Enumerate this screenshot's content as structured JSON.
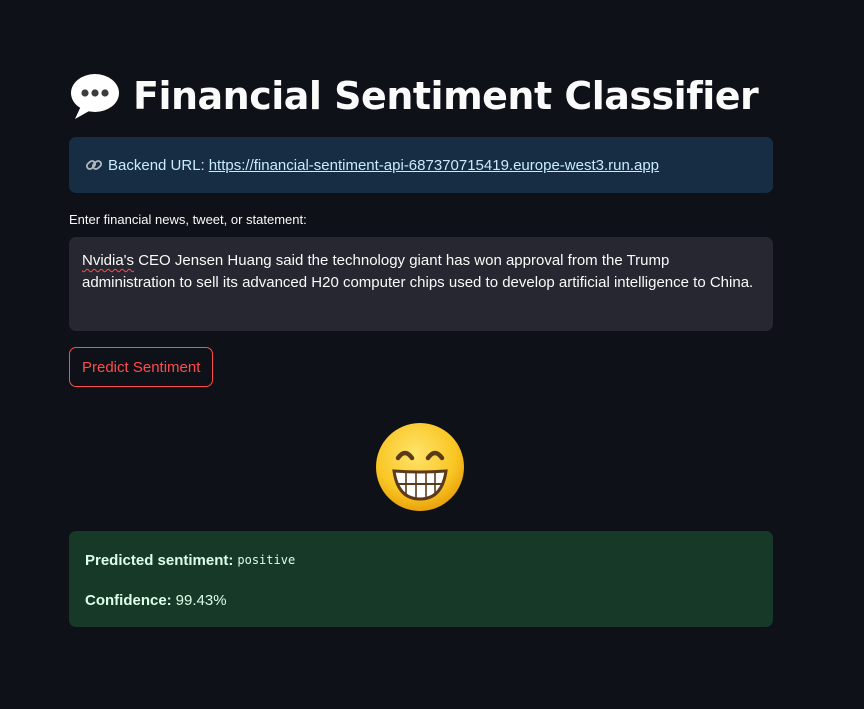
{
  "header": {
    "title_icon": "speech-balloon-icon",
    "title": "Financial Sentiment Classifier"
  },
  "backend": {
    "icon": "link-icon",
    "label": "Backend URL:",
    "url": "https://financial-sentiment-api-687370715419.europe-west3.run.app"
  },
  "input": {
    "label": "Enter financial news, tweet, or statement:",
    "value_first_word": "Nvidia's",
    "value_rest": " CEO Jensen Huang said the technology giant has won approval from the Trump administration to sell its advanced H20 computer chips used to develop artificial intelligence to China."
  },
  "actions": {
    "predict_label": "Predict Sentiment"
  },
  "result": {
    "emoji_icon": "grinning-face-icon",
    "sentiment_label": "Predicted sentiment:",
    "sentiment_value": "positive",
    "confidence_label": "Confidence:",
    "confidence_value": "99.43%"
  },
  "colors": {
    "background": "#0e1117",
    "info_bg": "#172d43",
    "success_bg": "#173928",
    "accent": "#ff4b4b"
  }
}
